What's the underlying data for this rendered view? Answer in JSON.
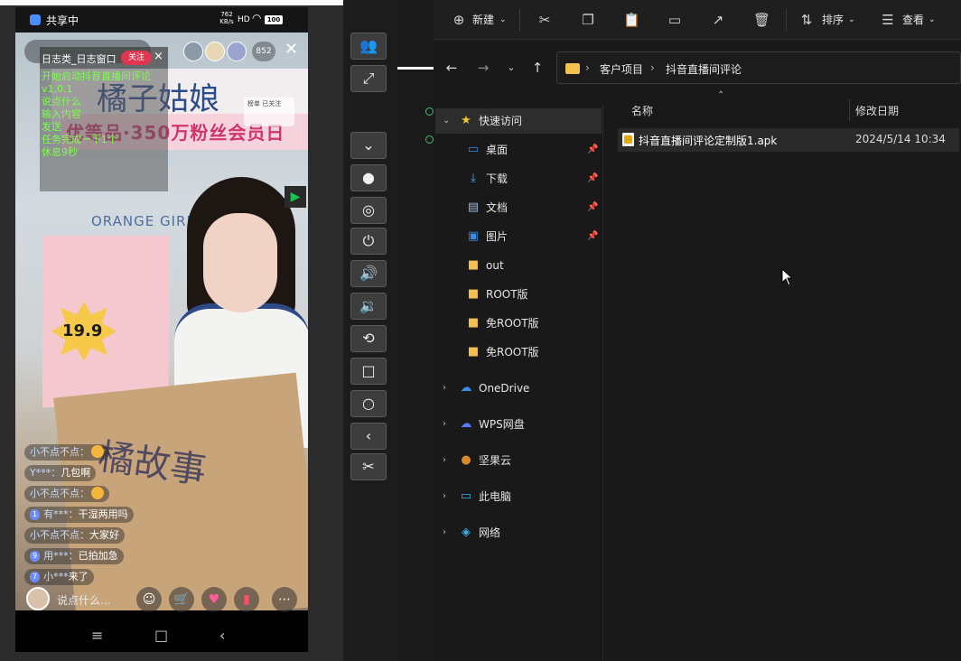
{
  "phone": {
    "status_bar": {
      "app_name": "共享中",
      "net_speed": "762 KB/s",
      "signal": "HD",
      "battery": "100"
    },
    "stream": {
      "brand_text": "橘子姑娘",
      "banner_text": "优等品·350万粉丝会员日",
      "orange_text": "ORANGE GIRL",
      "price_text": "19.9",
      "box_text": "橘故事",
      "viewer_count": "852",
      "ribbon_text": "榜单 已关注"
    },
    "log_window": {
      "title": "日志类_日志窗口",
      "follow_label": "关注",
      "close_label": "×",
      "lines": [
        "开始启动抖音直播间评论",
        "v1.0.1",
        "说点什么",
        "输入内容",
        "发送",
        "任务完成一下1个",
        "休息9秒"
      ]
    },
    "comments": [
      {
        "user": "小不点不点：",
        "text": "",
        "lvl": "",
        "emo": true
      },
      {
        "user": "Y***：",
        "text": "几包啊",
        "lvl": "",
        "emo": false
      },
      {
        "user": "小不点不点：",
        "text": "",
        "lvl": "",
        "emo": true
      },
      {
        "user": "有***：",
        "text": "干湿两用吗",
        "lvl": "1",
        "emo": false
      },
      {
        "user": "小不点不点：",
        "text": "大家好",
        "lvl": "",
        "emo": false
      },
      {
        "user": "用***：",
        "text": "已拍加急",
        "lvl": "9",
        "emo": false
      },
      {
        "user": "小***",
        "text": "来了",
        "lvl": "7",
        "emo": false
      }
    ],
    "comment_bar": {
      "placeholder": "说点什么..."
    }
  },
  "side_toolbar": {
    "buttons": [
      "users-icon",
      "fullscreen-icon",
      "expand-down-icon",
      "record-icon",
      "hide-icon",
      "power-icon",
      "volume-up-icon",
      "volume-down-icon",
      "rotate-icon",
      "home-icon",
      "circle-icon",
      "back-icon",
      "screenshot-icon"
    ]
  },
  "explorer": {
    "toolbar": {
      "new_label": "新建",
      "sort_label": "排序",
      "view_label": "查看"
    },
    "breadcrumb": [
      "客户项目",
      "抖音直播间评论"
    ],
    "nav": {
      "quick_access": "快速访问",
      "items": [
        {
          "label": "桌面",
          "pinned": true
        },
        {
          "label": "下载",
          "pinned": true
        },
        {
          "label": "文档",
          "pinned": true
        },
        {
          "label": "图片",
          "pinned": true
        },
        {
          "label": "out",
          "pinned": false
        },
        {
          "label": "ROOT版",
          "pinned": false
        },
        {
          "label": "免ROOT版",
          "pinned": false
        },
        {
          "label": "免ROOT版",
          "pinned": false
        }
      ],
      "roots": [
        "OneDrive",
        "WPS网盘",
        "坚果云",
        "此电脑",
        "网络"
      ]
    },
    "columns": {
      "name": "名称",
      "modified": "修改日期"
    },
    "files": [
      {
        "name": "抖音直播间评论定制版1.apk",
        "modified": "2024/5/14 10:34"
      }
    ]
  }
}
